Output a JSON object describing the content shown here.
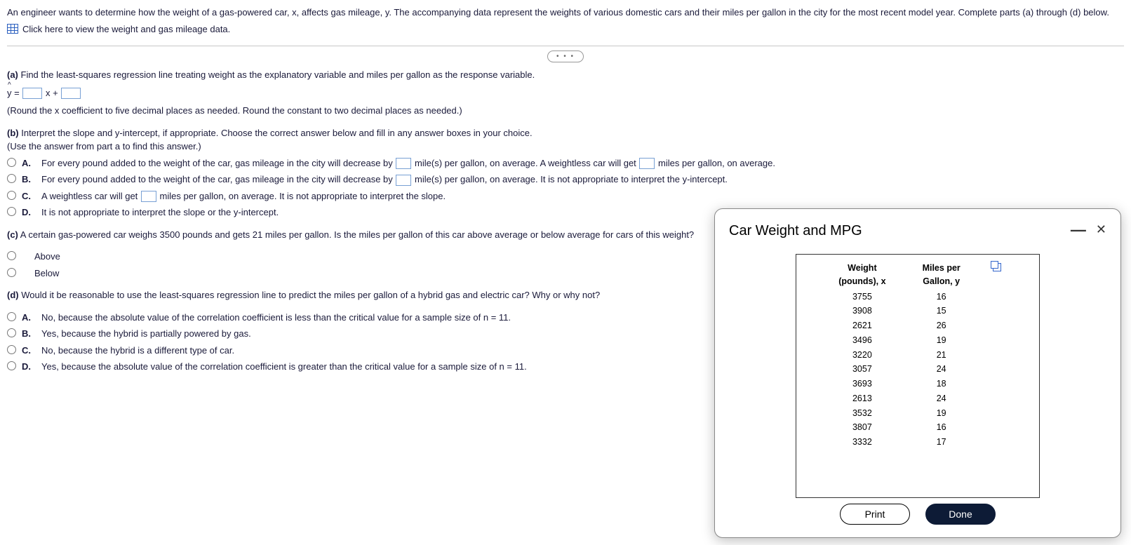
{
  "intro": "An engineer wants to determine how the weight of a gas-powered car, x, affects gas mileage, y. The accompanying data represent the weights of various domestic cars and their miles per gallon in the city for the most recent model year. Complete parts (a) through (d) below.",
  "data_link": "Click here to view the weight and gas mileage data.",
  "part_a": {
    "prompt_bold": "(a)",
    "prompt_rest": " Find the least-squares regression line treating weight as the explanatory variable and miles per gallon as the response variable.",
    "eq_left": "y =",
    "eq_mid": "x +",
    "hint": "(Round the x coefficient to five decimal places as needed. Round the constant to two decimal places as needed.)"
  },
  "part_b": {
    "prompt_bold": "(b)",
    "prompt_rest": " Interpret the slope and y-intercept, if appropriate. Choose the correct answer below and fill in any answer boxes in your choice.",
    "hint": "(Use the answer from part a to find this answer.)",
    "options": {
      "A": {
        "pre": "For every pound added to the weight of the car, gas mileage in the city will decrease by ",
        "mid": " mile(s) per gallon, on average. A weightless car will get ",
        "post": " miles per gallon, on average."
      },
      "B": {
        "pre": "For every pound added to the weight of the car, gas mileage in the city will decrease by ",
        "post": " mile(s) per gallon, on average. It is not appropriate to interpret the y-intercept."
      },
      "C": {
        "pre": "A weightless car will get ",
        "post": " miles per gallon, on average. It is not appropriate to interpret the slope."
      },
      "D": "It is not appropriate to interpret the slope or the y-intercept."
    }
  },
  "part_c": {
    "prompt_bold": "(c)",
    "prompt_rest": " A certain gas-powered car weighs 3500 pounds and gets 21 miles per gallon. Is the miles per gallon of this car above average or below average for cars of this weight?",
    "opt1": "Above",
    "opt2": "Below"
  },
  "part_d": {
    "prompt_bold": "(d)",
    "prompt_rest": " Would it be reasonable to use the least-squares regression line to predict the miles per gallon of a hybrid gas and electric car? Why or why not?",
    "options": {
      "A": "No, because the absolute value of the correlation coefficient is less than the critical value for a sample size of n = 11.",
      "B": "Yes, because the hybrid is partially powered by gas.",
      "C": "No, because the hybrid is a different type of car.",
      "D": "Yes, because the absolute value of the correlation coefficient is greater than the critical value for a sample size of n = 11."
    }
  },
  "popup": {
    "title": "Car Weight and MPG",
    "col1": "Weight (pounds), x",
    "col2": "Miles per Gallon, y",
    "print": "Print",
    "done": "Done"
  },
  "chart_data": {
    "type": "table",
    "columns": [
      "Weight (pounds), x",
      "Miles per Gallon, y"
    ],
    "rows": [
      [
        3755,
        16
      ],
      [
        3908,
        15
      ],
      [
        2621,
        26
      ],
      [
        3496,
        19
      ],
      [
        3220,
        21
      ],
      [
        3057,
        24
      ],
      [
        3693,
        18
      ],
      [
        2613,
        24
      ],
      [
        3532,
        19
      ],
      [
        3807,
        16
      ],
      [
        3332,
        17
      ]
    ]
  }
}
